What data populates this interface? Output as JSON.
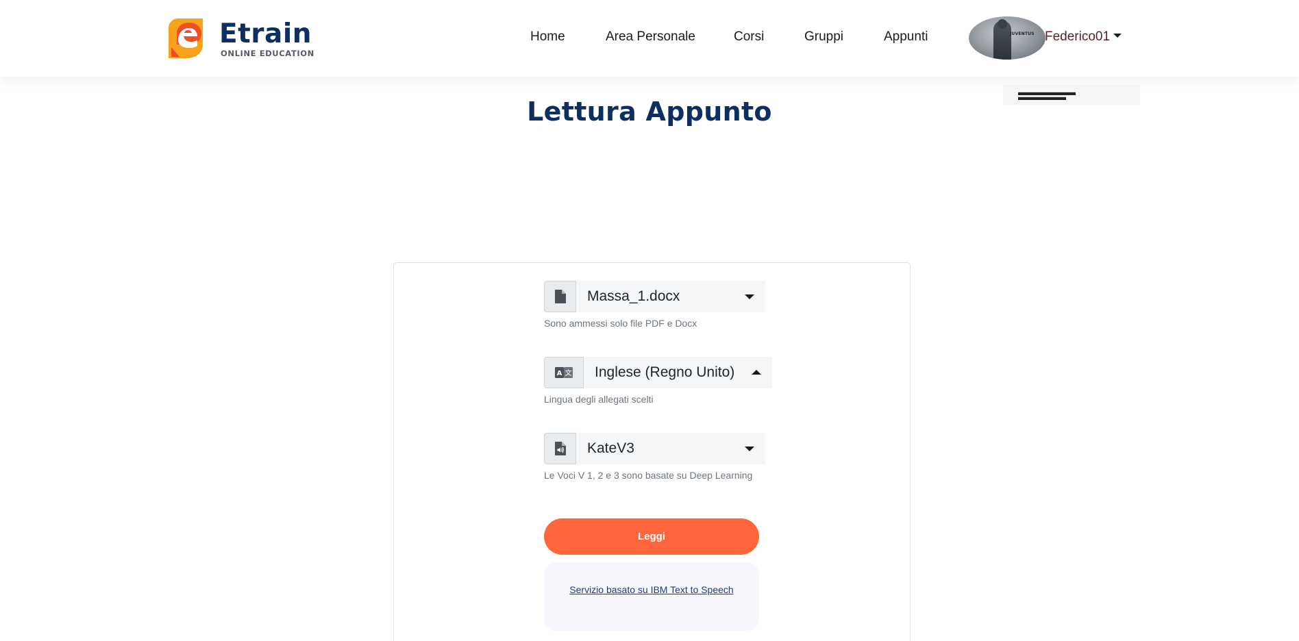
{
  "brand": {
    "name": "Etrain",
    "tagline": "ONLINE EDUCATION",
    "colors": {
      "navy": "#0c2e60",
      "logo_orange": "#f7a21b",
      "logo_red": "#ef4a26"
    }
  },
  "nav": {
    "items": [
      {
        "label": "Home"
      },
      {
        "label": "Area Personale"
      },
      {
        "label": "Corsi"
      },
      {
        "label": "Gruppi"
      },
      {
        "label": "Appunti"
      }
    ],
    "user": {
      "name": "Federico01",
      "avatar_caption": "JUVENTUS"
    }
  },
  "page": {
    "title": "Lettura Appunto"
  },
  "form": {
    "file": {
      "icon": "file-icon",
      "value": "Massa_1.docx",
      "help": "Sono ammessi solo file PDF e Docx"
    },
    "language": {
      "icon": "translate-icon",
      "value": "Inglese (Regno Unito)",
      "help": "Lingua degli allegati scelti"
    },
    "voice": {
      "icon": "audio-file-icon",
      "value": "KateV3",
      "help": "Le Voci V 1, 2 e 3 sono basate su Deep Learning"
    },
    "submit_label": "Leggi",
    "service_link": "Servizio basato su IBM Text to Speech"
  },
  "theme": {
    "accent": "#ff663c",
    "link": "#1f3a80",
    "muted": "#6c757d"
  }
}
